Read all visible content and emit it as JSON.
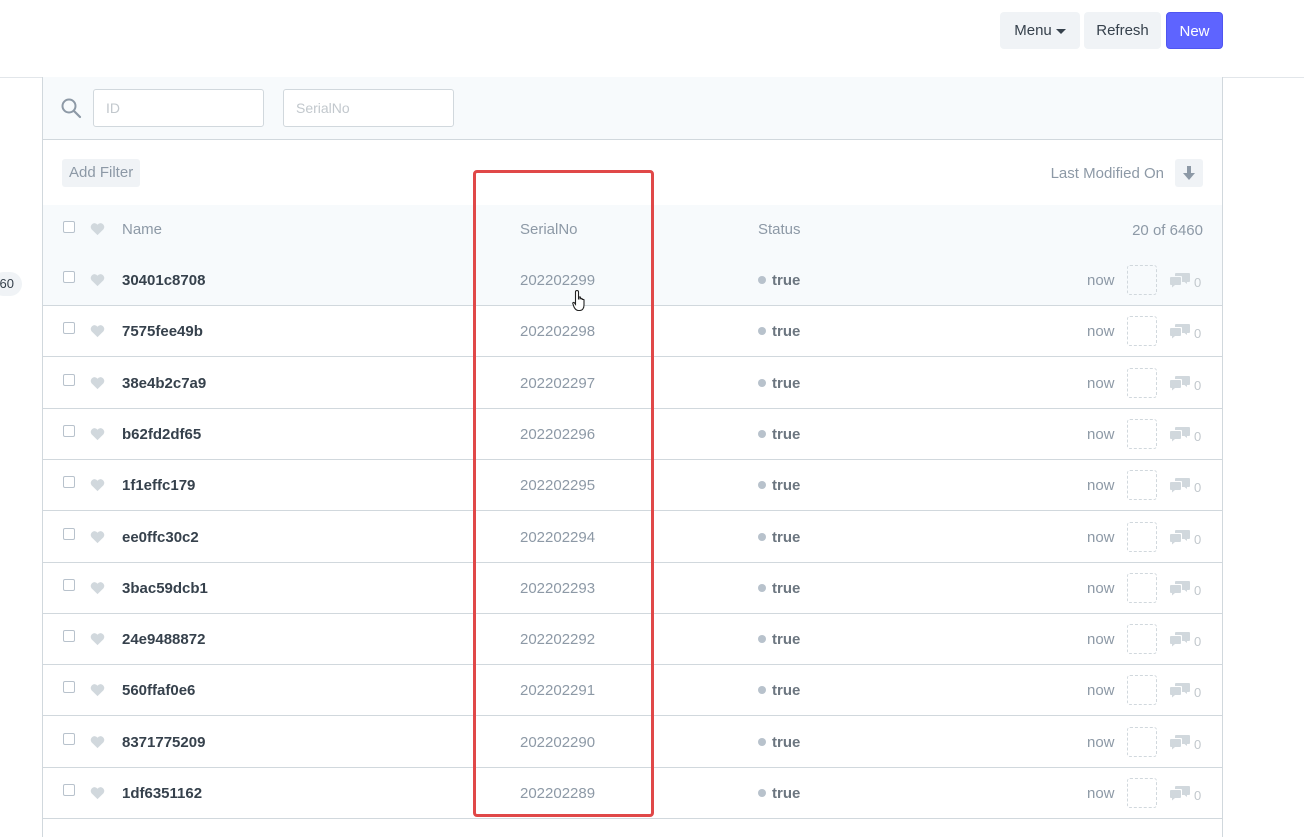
{
  "toolbar": {
    "menu_label": "Menu",
    "refresh_label": "Refresh",
    "new_label": "New"
  },
  "sidebar": {
    "badge": "60"
  },
  "filters": {
    "id_placeholder": "ID",
    "serial_placeholder": "SerialNo"
  },
  "list": {
    "add_filter_label": "Add Filter",
    "sort_label": "Last Modified On",
    "header": {
      "name": "Name",
      "serial": "SerialNo",
      "status": "Status",
      "count": "20 of 6460"
    },
    "rows": [
      {
        "name": "30401c8708",
        "serial": "202202299",
        "status": "true",
        "time": "now",
        "comments": "0"
      },
      {
        "name": "7575fee49b",
        "serial": "202202298",
        "status": "true",
        "time": "now",
        "comments": "0"
      },
      {
        "name": "38e4b2c7a9",
        "serial": "202202297",
        "status": "true",
        "time": "now",
        "comments": "0"
      },
      {
        "name": "b62fd2df65",
        "serial": "202202296",
        "status": "true",
        "time": "now",
        "comments": "0"
      },
      {
        "name": "1f1effc179",
        "serial": "202202295",
        "status": "true",
        "time": "now",
        "comments": "0"
      },
      {
        "name": "ee0ffc30c2",
        "serial": "202202294",
        "status": "true",
        "time": "now",
        "comments": "0"
      },
      {
        "name": "3bac59dcb1",
        "serial": "202202293",
        "status": "true",
        "time": "now",
        "comments": "0"
      },
      {
        "name": "24e9488872",
        "serial": "202202292",
        "status": "true",
        "time": "now",
        "comments": "0"
      },
      {
        "name": "560ffaf0e6",
        "serial": "202202291",
        "status": "true",
        "time": "now",
        "comments": "0"
      },
      {
        "name": "8371775209",
        "serial": "202202290",
        "status": "true",
        "time": "now",
        "comments": "0"
      },
      {
        "name": "1df6351162",
        "serial": "202202289",
        "status": "true",
        "time": "now",
        "comments": "0"
      }
    ]
  },
  "colors": {
    "primary": "#5e64ff",
    "highlight": "#e04848",
    "muted_text": "#8d99a6",
    "border": "#d1d8dd"
  }
}
